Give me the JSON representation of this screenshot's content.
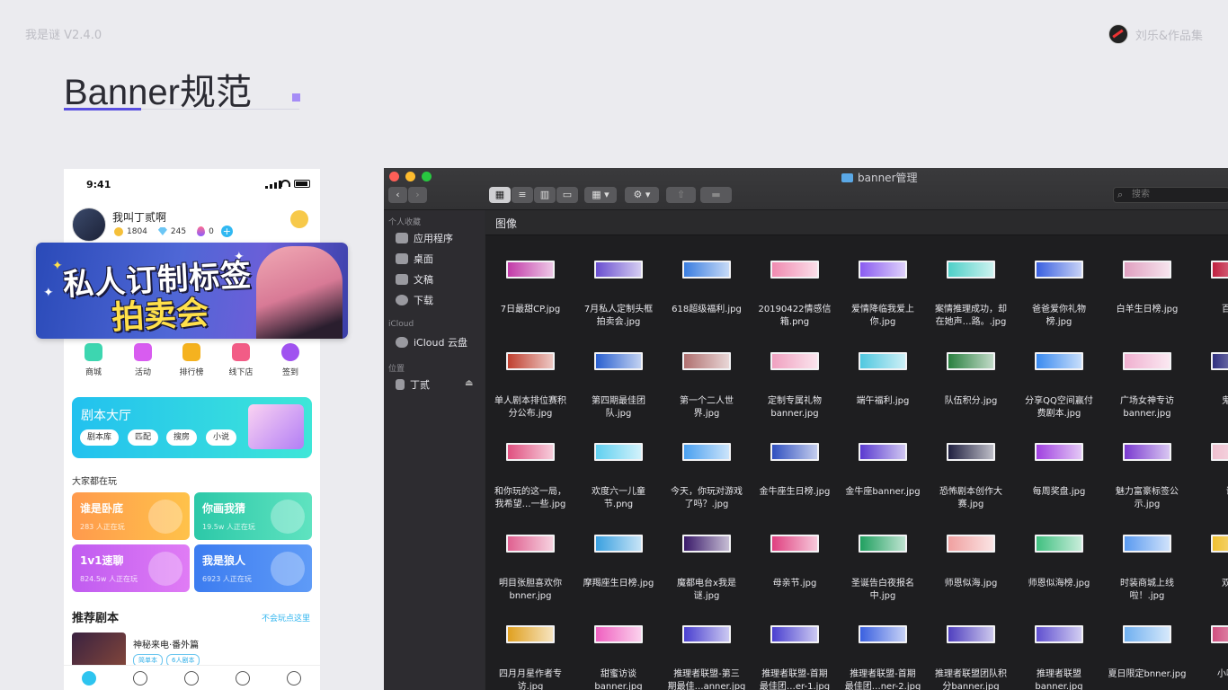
{
  "header": {
    "version": "我是谜 V2.4.0",
    "author": "刘乐&作品集",
    "page_title": "Banner规范"
  },
  "phone": {
    "time": "9:41",
    "user": {
      "name": "我叫丁贰啊",
      "coins": "1804",
      "gems": "245",
      "flames": "0",
      "plus": "+"
    },
    "banner": {
      "line1": "私人订制标签",
      "line2": "拍卖会"
    },
    "nav": [
      {
        "label": "商城",
        "color": "#3dd6b0"
      },
      {
        "label": "活动",
        "color": "#d85cf0"
      },
      {
        "label": "排行榜",
        "color": "#f5b21f"
      },
      {
        "label": "线下店",
        "color": "#f25c86"
      },
      {
        "label": "签到",
        "color": "#a052f0"
      }
    ],
    "hall": {
      "title": "剧本大厅",
      "chips": [
        "剧本库",
        "匹配",
        "搜房",
        "小说"
      ]
    },
    "playing_title": "大家都在玩",
    "games": [
      {
        "title": "谁是卧底",
        "sub": "283 人正在玩",
        "from": "#ff9a4d",
        "to": "#ffc24a"
      },
      {
        "title": "你画我猜",
        "sub": "19.5w 人正在玩",
        "from": "#2cc8a8",
        "to": "#5fe3c0"
      },
      {
        "title": "1v1速聊",
        "sub": "824.5w 人正在玩",
        "from": "#c05cf0",
        "to": "#e07cf5"
      },
      {
        "title": "我是狼人",
        "sub": "6923 人正在玩",
        "from": "#3c7cf0",
        "to": "#5f9bf7"
      }
    ],
    "recommend": {
      "title": "推荐剧本",
      "more": "不会玩点这里",
      "item_name": "神秘来电·番外篇",
      "tags": [
        "简单本",
        "6人剧本"
      ]
    }
  },
  "finder": {
    "window_title": "banner管理",
    "search_placeholder": "搜索",
    "sidebar": {
      "favorites_header": "个人收藏",
      "favorites": [
        "应用程序",
        "桌面",
        "文稿",
        "下载"
      ],
      "icloud_header": "iCloud",
      "icloud": [
        "iCloud 云盘"
      ],
      "locations_header": "位置",
      "locations": [
        "丁贰"
      ]
    },
    "folder_header": "图像",
    "files": [
      [
        "7日最甜CP.jpg",
        "7月私人定制头框\n拍卖会.jpg",
        "618超级福利.jpg",
        "20190422情感信\n箱.png",
        "爱情降临我爱上\n你.jpg",
        "案情推理成功，却\n在她声…路。.jpg",
        "爸爸爱你礼物\n榜.jpg",
        "白羊生日榜.jpg",
        "百鬼夜"
      ],
      [
        "单人剧本排位赛积\n分公布.jpg",
        "第四期最佳团\n队.jpg",
        "第一个二人世\n界.jpg",
        "定制专属礼物\nbanner.jpg",
        "端午福利.jpg",
        "队伍积分.jpg",
        "分享QQ空间赢付\n费剧本.jpg",
        "广场女神专访\nbanner.jpg",
        "鬼马精"
      ],
      [
        "和你玩的这一局，\n我希望…一些.jpg",
        "欢度六一儿童\n节.png",
        "今天，你玩对游戏\n了吗？.jpg",
        "金牛座生日榜.jpg",
        "金牛座banner.jpg",
        "恐怖剧本创作大\n赛.jpg",
        "每周奖盘.jpg",
        "魅力富豪标签公\n示.jpg",
        "谜砖"
      ],
      [
        "明目张胆喜欢你\nbnner.jpg",
        "摩羯座生日榜.jpg",
        "魔都电台x我是\n谜.jpg",
        "母亲节.jpg",
        "圣诞告白夜报名\n中.jpg",
        "师恩似海.jpg",
        "师恩似海榜.jpg",
        "时装商城上线\n啦！.jpg",
        "双鱼生"
      ],
      [
        "四月月星作者专\n访.jpg",
        "甜蜜访谈\nbanner.jpg",
        "推理者联盟-第三\n期最佳…anner.jpg",
        "推理者联盟-首期\n最佳团…er-1.jpg",
        "推理者联盟-首期\n最佳团…ner-2.jpg",
        "推理者联盟团队积\n分banner.jpg",
        "推理者联盟\nbanner.jpg",
        "夏日限定bnner.jpg",
        "小嘴叭叭"
      ]
    ],
    "thumb_colors": [
      [
        "#c23ba8",
        "#6a4fd0",
        "#3a7de0",
        "#f08ab0",
        "#8a5cf0",
        "#4fd0c8",
        "#3a60e0",
        "#e0a0c0",
        "#c02040"
      ],
      [
        "#c04030",
        "#2a60d0",
        "#b07070",
        "#f0a0c0",
        "#50c8e0",
        "#2a8040",
        "#3a8af0",
        "#f0b0d0",
        "#303080"
      ],
      [
        "#e05080",
        "#60d0f0",
        "#4aa0f0",
        "#3050c0",
        "#5a3ad0",
        "#202040",
        "#a040e0",
        "#7a3ad0",
        "#f0c0d0"
      ],
      [
        "#e06090",
        "#3aa0e0",
        "#3a1a6a",
        "#e04080",
        "#20a060",
        "#f0a0a0",
        "#40c080",
        "#5a9af0",
        "#f0c030"
      ],
      [
        "#e0a020",
        "#f060c0",
        "#4a40d0",
        "#4a40d0",
        "#3a60e0",
        "#5040c0",
        "#6050d0",
        "#70b0f0",
        "#d05080"
      ]
    ]
  }
}
